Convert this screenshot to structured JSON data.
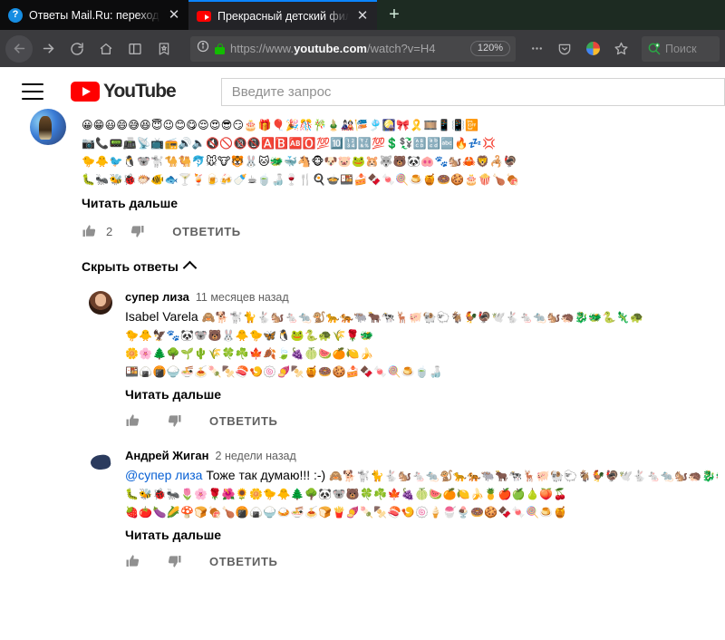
{
  "browser": {
    "tabs": [
      {
        "title": "Ответы Mail.Ru: переход по сс",
        "favicon": "mailru-icon",
        "active": false,
        "close_label": "✕"
      },
      {
        "title": "Прекрасный детский фильм",
        "favicon": "youtube-icon",
        "active": true,
        "close_label": "✕"
      }
    ],
    "newtab_label": "+",
    "nav": {
      "back_icon": "back-arrow-icon",
      "forward_icon": "forward-arrow-icon",
      "reload_icon": "reload-icon",
      "home_icon": "home-icon",
      "sidebar_icon": "sidebar-icon",
      "library_icon": "library-icon"
    },
    "urlbar": {
      "identity_icon": "info-circle-icon",
      "lock_icon": "padlock-icon",
      "scheme": "https://www.",
      "domain": "youtube.com",
      "path": "/watch?v=H4",
      "zoom_level": "120%"
    },
    "toolbar": {
      "menu_icon": "ellipsis-icon",
      "pocket_icon": "pocket-icon",
      "extension_icon": "extension-icon",
      "bookmark_icon": "star-icon"
    },
    "search": {
      "icon": "search-magnifier-icon",
      "placeholder": "Поиск"
    }
  },
  "youtube": {
    "header": {
      "menu_icon": "hamburger-menu-icon",
      "logo_icon": "youtube-logo-icon",
      "logo_text": "YouTube",
      "search_placeholder": "Введите запрос"
    },
    "top_comment": {
      "avatar": "commenter-avatar",
      "emoji_lines": [
        "😀😁😃😄😅😆😇😉😊😋😌😍😎😏🎂🎁🎈🎉🎊🎋🎍🎎🎏🎐🎑🎀🎗️🎞️📱📳📴",
        "📷📞📟📠📡📺📻🔊🔈🔇🚫🔞📵🅰️🅱️🆎🅾️💯🔟🔢🔣💯💲💱🔠🔡🔤🔥💤💢",
        "🐤🐥🐦🐧🐨🐩🐪🐫🐬🐭🐮🐯🐰🐱🐲🐳🐴🐵🐶🐷🐸🐹🐺🐻🐼🐽🐾🐿️🦀🦁🦂🦃",
        "🐛🐜🐝🐞🐡🐠🐟🍸🍹🍺🍻🍼☕🍵🍶🍷🍴🍳🍲🍱🍰🍫🍬🍭🍮🍯🍩🍪🎂🍿🍗🍖"
      ],
      "read_more": "Читать дальше",
      "like_icon": "thumbs-up-icon",
      "like_count": "2",
      "dislike_icon": "thumbs-down-icon",
      "reply_label": "ОТВЕТИТЬ",
      "hide_replies_label": "Скрыть ответы",
      "hide_replies_icon": "chevron-up-icon"
    },
    "replies": [
      {
        "avatar": "liza-avatar",
        "author": "супер лиза",
        "timestamp": "11 месяцев назад",
        "text_prefix": "Isabel Varela ",
        "mention": "",
        "text_after": "",
        "emoji_lines": [
          "🙈🐕🐩🐈🐇🐿️🐁🐀🐒🐆🐅🐃🐂🐄🦌🐖🐏🐑🐐🐓🦃🕊️🐇🐁🐀🐿️🦔🐉🐲🐍🦎🐢",
          "🐤🐥🦅🐾🐼🐨🐻🐰🐥🐤🦋🐧🐸🐍🐢🌾🌹🐲",
          "🌼🌸🌲🌳🌱🌵🌾🍀☘️🍁🍂🍃🍇🍈🍉🍊🍋🍌",
          "🍱🍙🍘🍚🍜🍝🍡🍢🍣🍤🍥🍠🍢🍯🍩🍪🍰🍫🍬🍭🍮🍵🍶"
        ],
        "read_more": "Читать дальше",
        "like_icon": "thumbs-up-icon",
        "like_count": "",
        "dislike_icon": "thumbs-down-icon",
        "reply_label": "ОТВЕТИТЬ"
      },
      {
        "avatar": "andrey-avatar",
        "author": "Андрей Жиган",
        "timestamp": "2 недели назад",
        "mention": "@супер лиза",
        "text_after": "  Тоже так думаю!!! :-) ",
        "text_prefix": "",
        "emoji_lines": [
          "🙈🐕🐩🐈🐇🐿️🐁🐀🐒🐆🐅🐃🐂🐄🦌🐖🐏🐑🐐🐓🦃🕊️🐇🐁🐀🐿️🦔🐉🐲🐍🦎🐢",
          "🐛🐝🐞🐜🌷🌸🌹🌺🌻🌼🐤🐥🌲🌳🐼🐨🐻🍀☘️🍁🍇🍈🍉🍊🍋🍌🍍🍎🍏🍐🍑🍒",
          "🍓🍅🍆🌽🍄🍞🍖🍗🍘🍙🍚🍛🍜🍝🍞🍟🍠🍡🍢🍣🍤🍥🍦🍧🍨🍩🍪🍫🍬🍭🍮🍯"
        ],
        "read_more": "Читать дальше",
        "like_icon": "thumbs-up-icon",
        "like_count": "",
        "dislike_icon": "thumbs-down-icon",
        "reply_label": "ОТВЕТИТЬ"
      }
    ]
  },
  "colors": {
    "accent_blue": "#0a84ff",
    "youtube_red": "#ff0000",
    "link_blue": "#065fd4",
    "lock_green": "#12bc00",
    "chrome_bg": "#3b3b3e",
    "tabstrip_bg": "#0c0c0d"
  }
}
